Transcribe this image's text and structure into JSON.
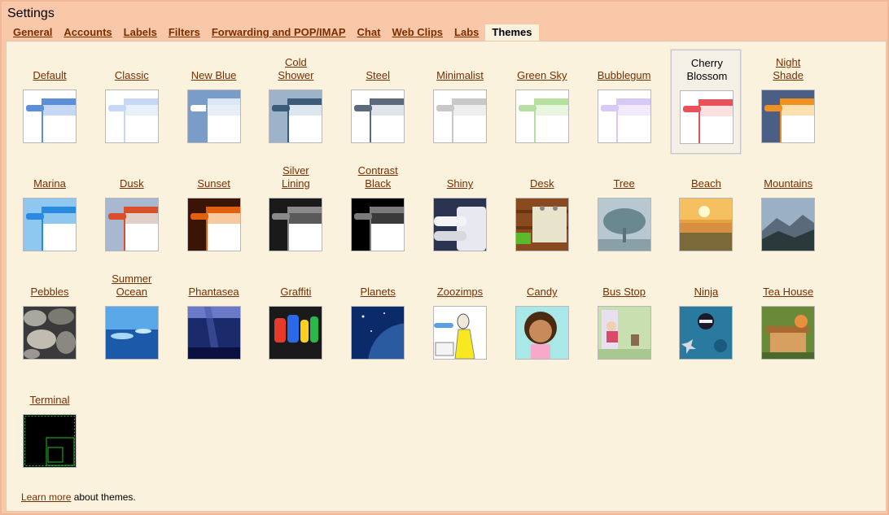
{
  "settings": {
    "title": "Settings"
  },
  "tabs": [
    "General",
    "Accounts",
    "Labels",
    "Filters",
    "Forwarding and POP/IMAP",
    "Chat",
    "Web Clips",
    "Labs",
    "Themes"
  ],
  "active_tab": "Themes",
  "themes": [
    {
      "name": "Default",
      "lines": [
        "Default"
      ],
      "icon": "ui-theme",
      "colors": {
        "bg": "#ffffff",
        "bar": "#5b8fd9",
        "header": "#5b8fd9",
        "header2": "#c6d8f6",
        "vline": "#5b8fd9"
      }
    },
    {
      "name": "Classic",
      "lines": [
        "Classic"
      ],
      "icon": "ui-theme",
      "colors": {
        "bg": "#ffffff",
        "bar": "#c6d8f6",
        "header": "#c6d8f6",
        "header2": "#e8f0fc",
        "vline": "#c6d8f6"
      }
    },
    {
      "name": "New Blue",
      "lines": [
        "New Blue"
      ],
      "icon": "ui-theme",
      "colors": {
        "bg": "#7a9cc8",
        "bar": "#ffffff",
        "header": "#dbe6f6",
        "header2": "#e8eef8",
        "vline": "#7a9cc8"
      }
    },
    {
      "name": "Cold Shower",
      "lines": [
        "Cold",
        "Shower"
      ],
      "icon": "ui-theme",
      "colors": {
        "bg": "#9db3ca",
        "bar": "#3c5a7a",
        "header": "#3c5a7a",
        "header2": "#dde5ee",
        "vline": "#3c5a7a"
      }
    },
    {
      "name": "Steel",
      "lines": [
        "Steel"
      ],
      "icon": "ui-theme",
      "colors": {
        "bg": "#ffffff",
        "bar": "#5c6a7e",
        "header": "#5c6a7e",
        "header2": "#dfe3ea",
        "vline": "#5c6a7e"
      }
    },
    {
      "name": "Minimalist",
      "lines": [
        "Minimalist"
      ],
      "icon": "ui-theme",
      "colors": {
        "bg": "#ffffff",
        "bar": "#c8c8c8",
        "header": "#c8c8c8",
        "header2": "#eeeeee",
        "vline": "#c8c8c8"
      }
    },
    {
      "name": "Green Sky",
      "lines": [
        "Green Sky"
      ],
      "icon": "ui-theme",
      "colors": {
        "bg": "#ffffff",
        "bar": "#b5e0a0",
        "header": "#b5e0a0",
        "header2": "#e8f6e0",
        "vline": "#b5e0a0"
      }
    },
    {
      "name": "Bubblegum",
      "lines": [
        "Bubblegum"
      ],
      "icon": "ui-theme",
      "colors": {
        "bg": "#ffffff",
        "bar": "#d8c8f6",
        "header": "#d8c8f6",
        "header2": "#f0eafc",
        "vline": "#d8c8f6"
      }
    },
    {
      "name": "Cherry Blossom",
      "lines": [
        "Cherry",
        "Blossom"
      ],
      "icon": "ui-theme",
      "selected": true,
      "colors": {
        "bg": "#ffffff",
        "bar": "#e8505a",
        "header": "#e8505a",
        "header2": "#fde0e0",
        "vline": "#e8505a"
      }
    },
    {
      "name": "Night Shade",
      "lines": [
        "Night",
        "Shade"
      ],
      "icon": "ui-theme",
      "colors": {
        "bg": "#4a5e86",
        "bar": "#f09020",
        "header": "#f09020",
        "header2": "#fde0b0",
        "vline": "#f09020"
      }
    },
    {
      "name": "Marina",
      "lines": [
        "Marina"
      ],
      "icon": "ui-theme",
      "colors": {
        "bg": "#8ec8f0",
        "bar": "#2a8ae0",
        "header": "#2a8ae0",
        "header2": "#8ec8f0",
        "vline": "#2a8ae0"
      }
    },
    {
      "name": "Dusk",
      "lines": [
        "Dusk"
      ],
      "icon": "ui-theme",
      "colors": {
        "bg": "#a8b8d0",
        "bar": "#d8502a",
        "header": "#d8502a",
        "header2": "#e0d0c8",
        "vline": "#d8502a"
      }
    },
    {
      "name": "Sunset",
      "lines": [
        "Sunset"
      ],
      "icon": "ui-theme",
      "colors": {
        "bg": "#3a1404",
        "bar": "#e06010",
        "header": "#e06010",
        "header2": "#f8c8a0",
        "vline": "#e06010"
      }
    },
    {
      "name": "Silver Lining",
      "lines": [
        "Silver",
        "Lining"
      ],
      "icon": "ui-theme",
      "colors": {
        "bg": "#1a1a1a",
        "bar": "#8a8a8a",
        "header": "#8a8a8a",
        "header2": "#5a5a5a",
        "vline": "#8a8a8a"
      }
    },
    {
      "name": "Contrast Black",
      "lines": [
        "Contrast",
        "Black"
      ],
      "icon": "ui-theme",
      "colors": {
        "bg": "#000000",
        "bar": "#7a7a7a",
        "header": "#7a7a7a",
        "header2": "#3a3a3a",
        "vline": "#7a7a7a"
      }
    },
    {
      "name": "Shiny",
      "lines": [
        "Shiny"
      ],
      "icon": "shiny",
      "colors": {
        "bg": "#2a3450",
        "bar": "#e8e8f0"
      }
    },
    {
      "name": "Desk",
      "lines": [
        "Desk"
      ],
      "icon": "desk",
      "colors": {
        "bg": "#8a4a20"
      }
    },
    {
      "name": "Tree",
      "lines": [
        "Tree"
      ],
      "icon": "tree",
      "colors": {
        "bg": "#b8c8d0"
      }
    },
    {
      "name": "Beach",
      "lines": [
        "Beach"
      ],
      "icon": "beach",
      "colors": {
        "bg": "#e8a040"
      }
    },
    {
      "name": "Mountains",
      "lines": [
        "Mountains"
      ],
      "icon": "mountains",
      "colors": {
        "bg": "#5a6a7a"
      }
    },
    {
      "name": "Pebbles",
      "lines": [
        "Pebbles"
      ],
      "icon": "pebbles",
      "colors": {
        "bg": "#6a6a6a"
      }
    },
    {
      "name": "Summer Ocean",
      "lines": [
        "Summer",
        "Ocean"
      ],
      "icon": "ocean",
      "colors": {
        "bg": "#3a7ac8"
      }
    },
    {
      "name": "Phantasea",
      "lines": [
        "Phantasea"
      ],
      "icon": "phantasea",
      "colors": {
        "bg": "#1a2a6a"
      }
    },
    {
      "name": "Graffiti",
      "lines": [
        "Graffiti"
      ],
      "icon": "graffiti",
      "colors": {
        "bg": "#1a1a1a"
      }
    },
    {
      "name": "Planets",
      "lines": [
        "Planets"
      ],
      "icon": "planets",
      "colors": {
        "bg": "#2a5aa0"
      }
    },
    {
      "name": "Zoozimps",
      "lines": [
        "Zoozimps"
      ],
      "icon": "zoozimps",
      "colors": {
        "bg": "#ffffff"
      }
    },
    {
      "name": "Candy",
      "lines": [
        "Candy"
      ],
      "icon": "candy",
      "colors": {
        "bg": "#a8e8e8"
      }
    },
    {
      "name": "Bus Stop",
      "lines": [
        "Bus Stop"
      ],
      "icon": "busstop",
      "colors": {
        "bg": "#c8e0b0"
      }
    },
    {
      "name": "Ninja",
      "lines": [
        "Ninja"
      ],
      "icon": "ninja",
      "colors": {
        "bg": "#2a7aa0"
      }
    },
    {
      "name": "Tea House",
      "lines": [
        "Tea House"
      ],
      "icon": "teahouse",
      "colors": {
        "bg": "#6a8a3a"
      }
    },
    {
      "name": "Terminal",
      "lines": [
        "Terminal"
      ],
      "icon": "terminal",
      "colors": {
        "bg": "#000000",
        "fg": "#20c020"
      }
    }
  ],
  "footer": {
    "link": "Learn more",
    "text": " about themes."
  }
}
